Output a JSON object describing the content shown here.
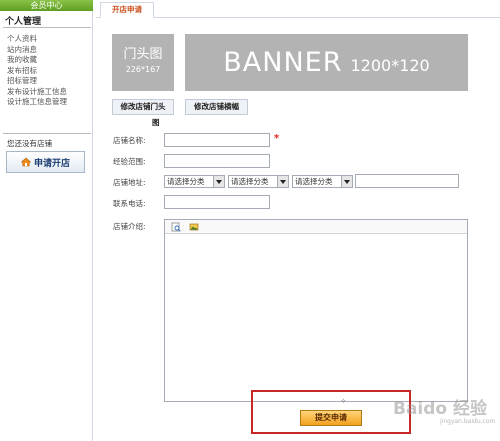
{
  "sidebar": {
    "header": "会员中心",
    "section_title": "个人管理",
    "items": [
      {
        "label": "个人资料"
      },
      {
        "label": "站内消息"
      },
      {
        "label": "我的收藏"
      },
      {
        "label": "发布招标"
      },
      {
        "label": "招标管理"
      },
      {
        "label": "发布设计施工信息"
      },
      {
        "label": "设计施工信息管理"
      }
    ],
    "no_shop_text": "您还没有店铺",
    "open_shop_button": "申请开店"
  },
  "tabs": [
    {
      "label": "开店申请"
    }
  ],
  "images": {
    "door": {
      "title": "门头图",
      "size": "226*167"
    },
    "banner": {
      "title": "BANNER",
      "size": "1200*120"
    }
  },
  "buttons": {
    "edit_door_line1": "修改店铺门头",
    "edit_door_line2": "图",
    "edit_banner": "修改店铺横幅"
  },
  "form": {
    "shop_name_label": "店铺名称:",
    "shop_name_value": "",
    "required_mark": "*",
    "scope_label": "经验范围:",
    "scope_value": "",
    "address_label": "店铺地址:",
    "address_selects": [
      "请选择分类",
      "请选择分类",
      "请选择分类"
    ],
    "address_detail_value": "",
    "phone_label": "联系电话:",
    "phone_value": "",
    "intro_label": "店铺介绍:"
  },
  "editor": {
    "toolbar": [
      {
        "icon": "source-icon"
      },
      {
        "icon": "image-icon"
      }
    ],
    "resize_glyph": "⟡"
  },
  "submit_button": "提交申请",
  "watermark": {
    "text": "Baido 经验",
    "sub": "jingyan.baidu.com"
  },
  "colors": {
    "sidebar_header": "#6aaa2a",
    "tab_text": "#c9501e",
    "placeholder_gray": "#b3b3b3",
    "highlight_border": "#c62828",
    "submit_bg": "#f2a11d",
    "required": "#e0251b"
  }
}
